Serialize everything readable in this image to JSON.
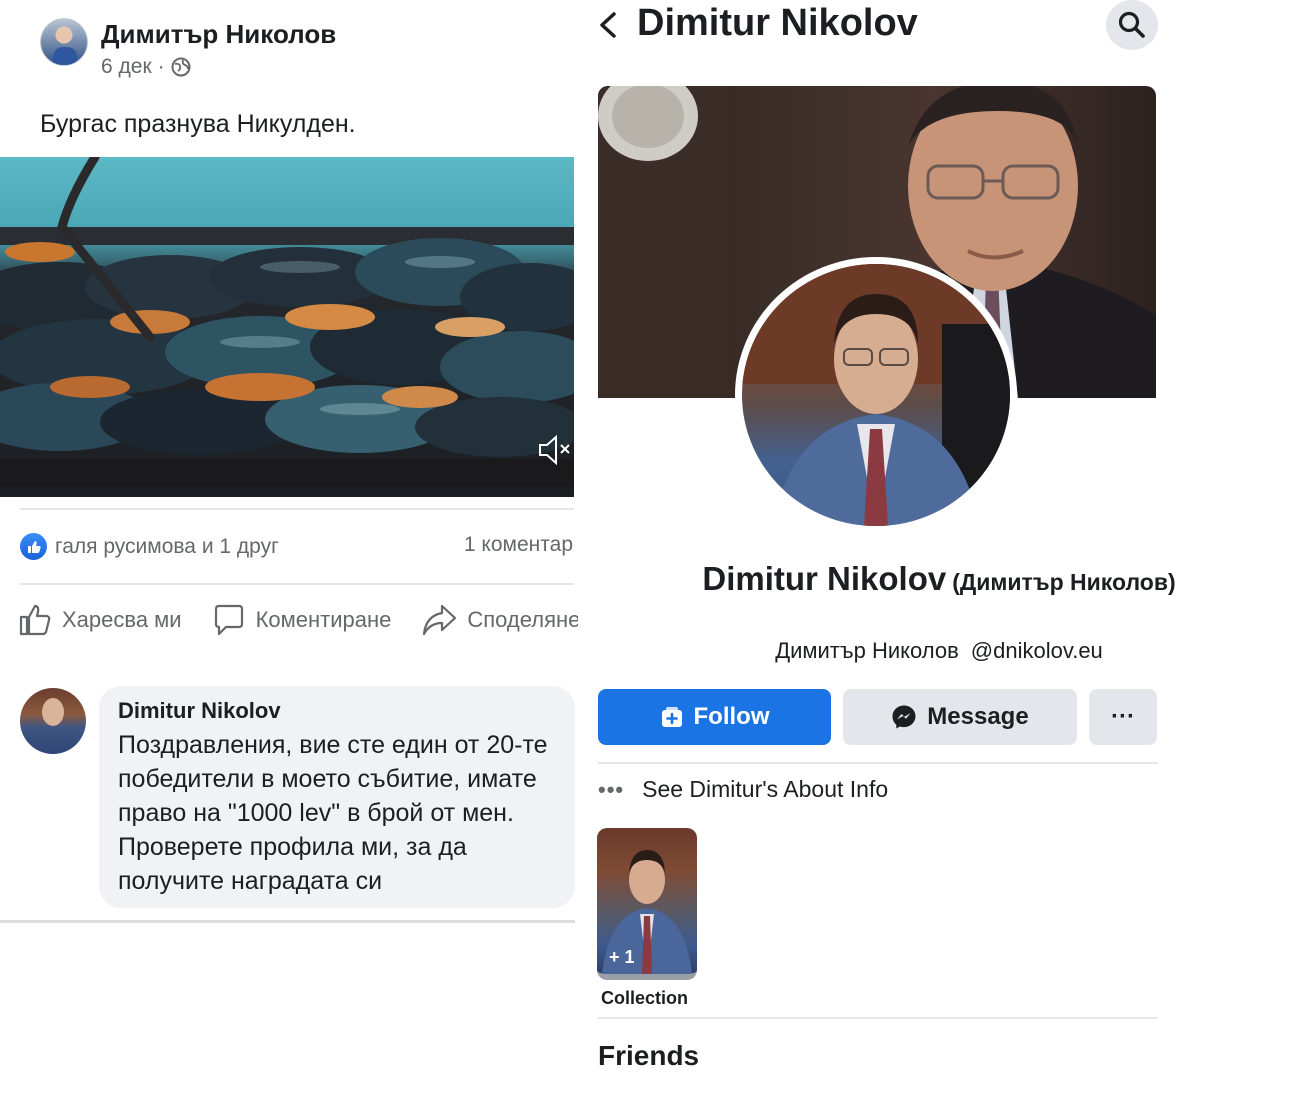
{
  "post": {
    "author": "Димитър Николов",
    "date": "6 дек",
    "separator": "·",
    "text": "Бургас празнува Никулден.",
    "reactions_text": "галя русимова и 1 друг",
    "comments_text": "1 коментар",
    "actions": {
      "like": "Харесва ми",
      "comment": "Коментиране",
      "share": "Споделяне"
    }
  },
  "comment": {
    "author": "Dimitur Nikolov",
    "text": "Поздравления, вие сте един от 20-те победители в моето събитие, имате право на \"1000 lev\" в брой от мен. Проверете профила ми, за да получите наградата си"
  },
  "profile": {
    "header_title": "Dimitur Nikolov",
    "display_name": "Dimitur Nikolov",
    "alternate_name": "(Димитър Николов)",
    "handle_name": "Димитър Николов",
    "handle": "@dnikolov.eu",
    "follow_label": "Follow",
    "message_label": "Message",
    "more_label": "···",
    "about_label": "See Dimitur's About Info",
    "collection_count": "+ 1",
    "collection_label": "Collection",
    "friends_heading": "Friends"
  },
  "colors": {
    "accent": "#1b74e4",
    "secondary_button": "#e4e6eb",
    "muted_text": "#65676b",
    "comment_bubble": "#f0f2f5"
  },
  "icons": [
    "globe-icon",
    "mute-icon",
    "like-reaction-icon",
    "thumbs-up-icon",
    "comment-icon",
    "share-icon",
    "back-arrow-icon",
    "search-icon",
    "follow-icon",
    "messenger-icon",
    "more-dots-icon"
  ]
}
